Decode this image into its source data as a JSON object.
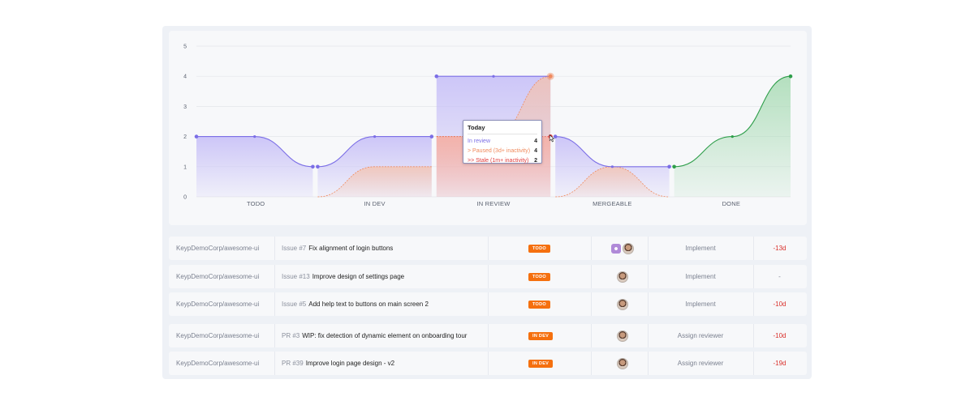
{
  "chart_data": {
    "type": "area",
    "categories": [
      "TODO",
      "IN DEV",
      "IN REVIEW",
      "MERGEABLE",
      "DONE"
    ],
    "ylim": [
      0,
      5
    ],
    "yticks": [
      "0",
      "1",
      "2",
      "3",
      "4",
      "5"
    ],
    "grid": true,
    "segments": [
      {
        "category": "TODO",
        "total": [
          2,
          2,
          1
        ],
        "paused": [
          0,
          0,
          0
        ],
        "stale": [
          0,
          0,
          0
        ]
      },
      {
        "category": "IN DEV",
        "total": [
          1,
          2,
          2
        ],
        "paused": [
          0,
          1,
          1
        ],
        "stale": [
          0,
          0,
          0
        ]
      },
      {
        "category": "IN REVIEW",
        "total": [
          4,
          4,
          4
        ],
        "paused": [
          2,
          2,
          4
        ],
        "stale": [
          2,
          2,
          2
        ]
      },
      {
        "category": "MERGEABLE",
        "total": [
          2,
          1,
          1
        ],
        "paused": [
          0,
          1,
          0
        ],
        "stale": [
          0,
          0,
          0
        ]
      },
      {
        "category": "DONE",
        "total": [
          1,
          2,
          4
        ],
        "paused": [
          0,
          0,
          0
        ],
        "stale": [
          0,
          0,
          0
        ]
      }
    ],
    "colors": {
      "total": "#7b6ee6",
      "total_fill": "#c5bdf7",
      "paused": "#f08a5d",
      "paused_fill": "#f7c1a8",
      "stale": "#e23b3b",
      "stale_fill": "#f4a0a0",
      "done": "#2e9e4a",
      "done_fill": "#a8dbb4"
    },
    "tooltip": {
      "title": "Today",
      "rows": [
        {
          "label": "In review",
          "value": "4",
          "color": "#7b6ee6"
        },
        {
          "label": "> Paused (3d+ inactivity)",
          "value": "4",
          "color": "#f08a5d"
        },
        {
          "label": ">> Stale (1m+ inactivity)",
          "value": "2",
          "color": "#e23b3b"
        }
      ]
    }
  },
  "rows": [
    {
      "repo": "KeypDemoCorp/awesome-ui",
      "kind": "Issue #7",
      "title": "Fix alignment of login buttons",
      "status": "TODO",
      "avatars": [
        "bot",
        "person"
      ],
      "action": "Implement",
      "days": "-13d"
    },
    {
      "repo": "KeypDemoCorp/awesome-ui",
      "kind": "Issue #13",
      "title": "Improve design of settings page",
      "status": "TODO",
      "avatars": [
        "person"
      ],
      "action": "Implement",
      "days": "-"
    },
    {
      "repo": "KeypDemoCorp/awesome-ui",
      "kind": "Issue #5",
      "title": "Add help text to buttons on main screen 2",
      "status": "TODO",
      "avatars": [
        "person"
      ],
      "action": "Implement",
      "days": "-10d"
    },
    {
      "repo": "KeypDemoCorp/awesome-ui",
      "kind": "PR #3",
      "title": "WIP: fix detection of dynamic element on onboarding tour",
      "status": "IN DEV",
      "avatars": [
        "person"
      ],
      "action": "Assign reviewer",
      "days": "-10d"
    },
    {
      "repo": "KeypDemoCorp/awesome-ui",
      "kind": "PR #39",
      "title": "Improve login page design - v2",
      "status": "IN DEV",
      "avatars": [
        "person"
      ],
      "action": "Assign reviewer",
      "days": "-19d"
    }
  ]
}
